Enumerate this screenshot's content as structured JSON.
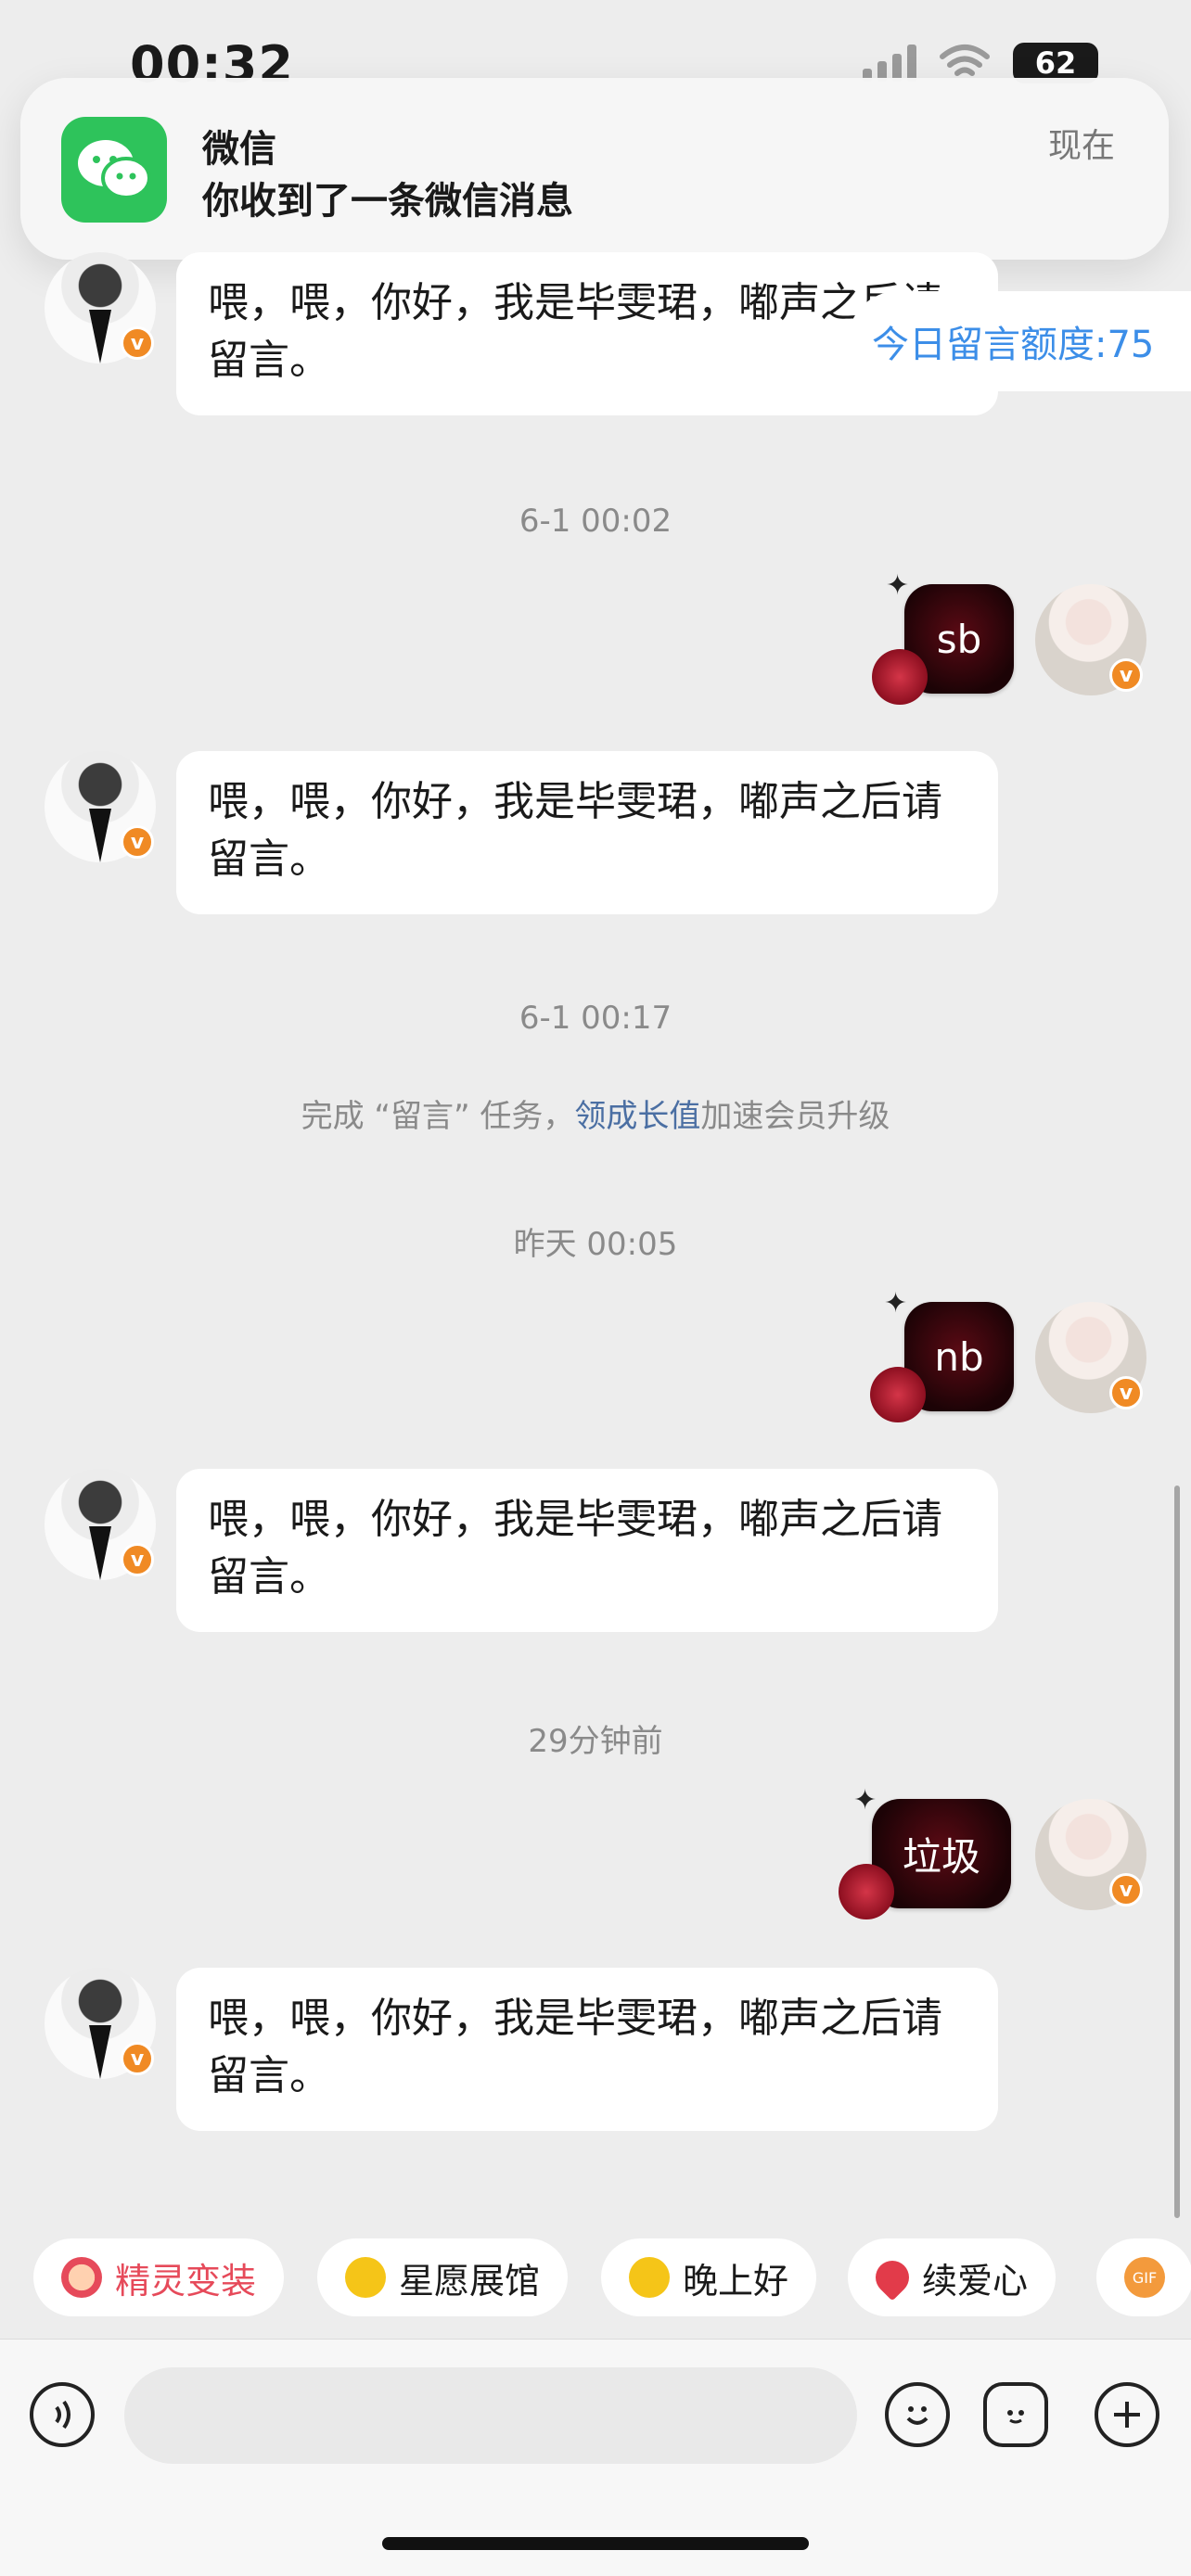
{
  "status_bar": {
    "time": "00:32",
    "battery": "62"
  },
  "notification": {
    "app_name": "微信",
    "message": "你收到了一条微信消息",
    "time": "现在"
  },
  "quota_tag": "今日留言额度:75",
  "messages": {
    "auto_reply": "喂，喂，你好，我是毕雯珺，嘟声之后请留言。",
    "timestamp_1": "6-1 00:02",
    "sticker_1": "sb",
    "timestamp_2": "6-1 00:17",
    "task_prefix": "完成 “留言” 任务，",
    "task_link": "领成长值",
    "task_suffix": "加速会员升级",
    "timestamp_3": "昨天 00:05",
    "sticker_2": "nb",
    "timestamp_4": "29分钟前",
    "sticker_3": "垃圾"
  },
  "badges": {
    "verified": "v"
  },
  "chips": [
    {
      "label": "精灵变装",
      "icon": "elf-icon",
      "color": "#e64a5a"
    },
    {
      "label": "星愿展馆",
      "icon": "star-icon"
    },
    {
      "label": "晚上好",
      "icon": "star-face-icon"
    },
    {
      "label": "续爱心",
      "icon": "heart-icon"
    },
    {
      "label": "GIF",
      "icon": "gif-icon"
    }
  ],
  "input": {
    "placeholder": ""
  },
  "colors": {
    "accent_blue": "#3c8ee8",
    "wechat_green": "#2ec35b",
    "badge_orange": "#f08a24"
  }
}
